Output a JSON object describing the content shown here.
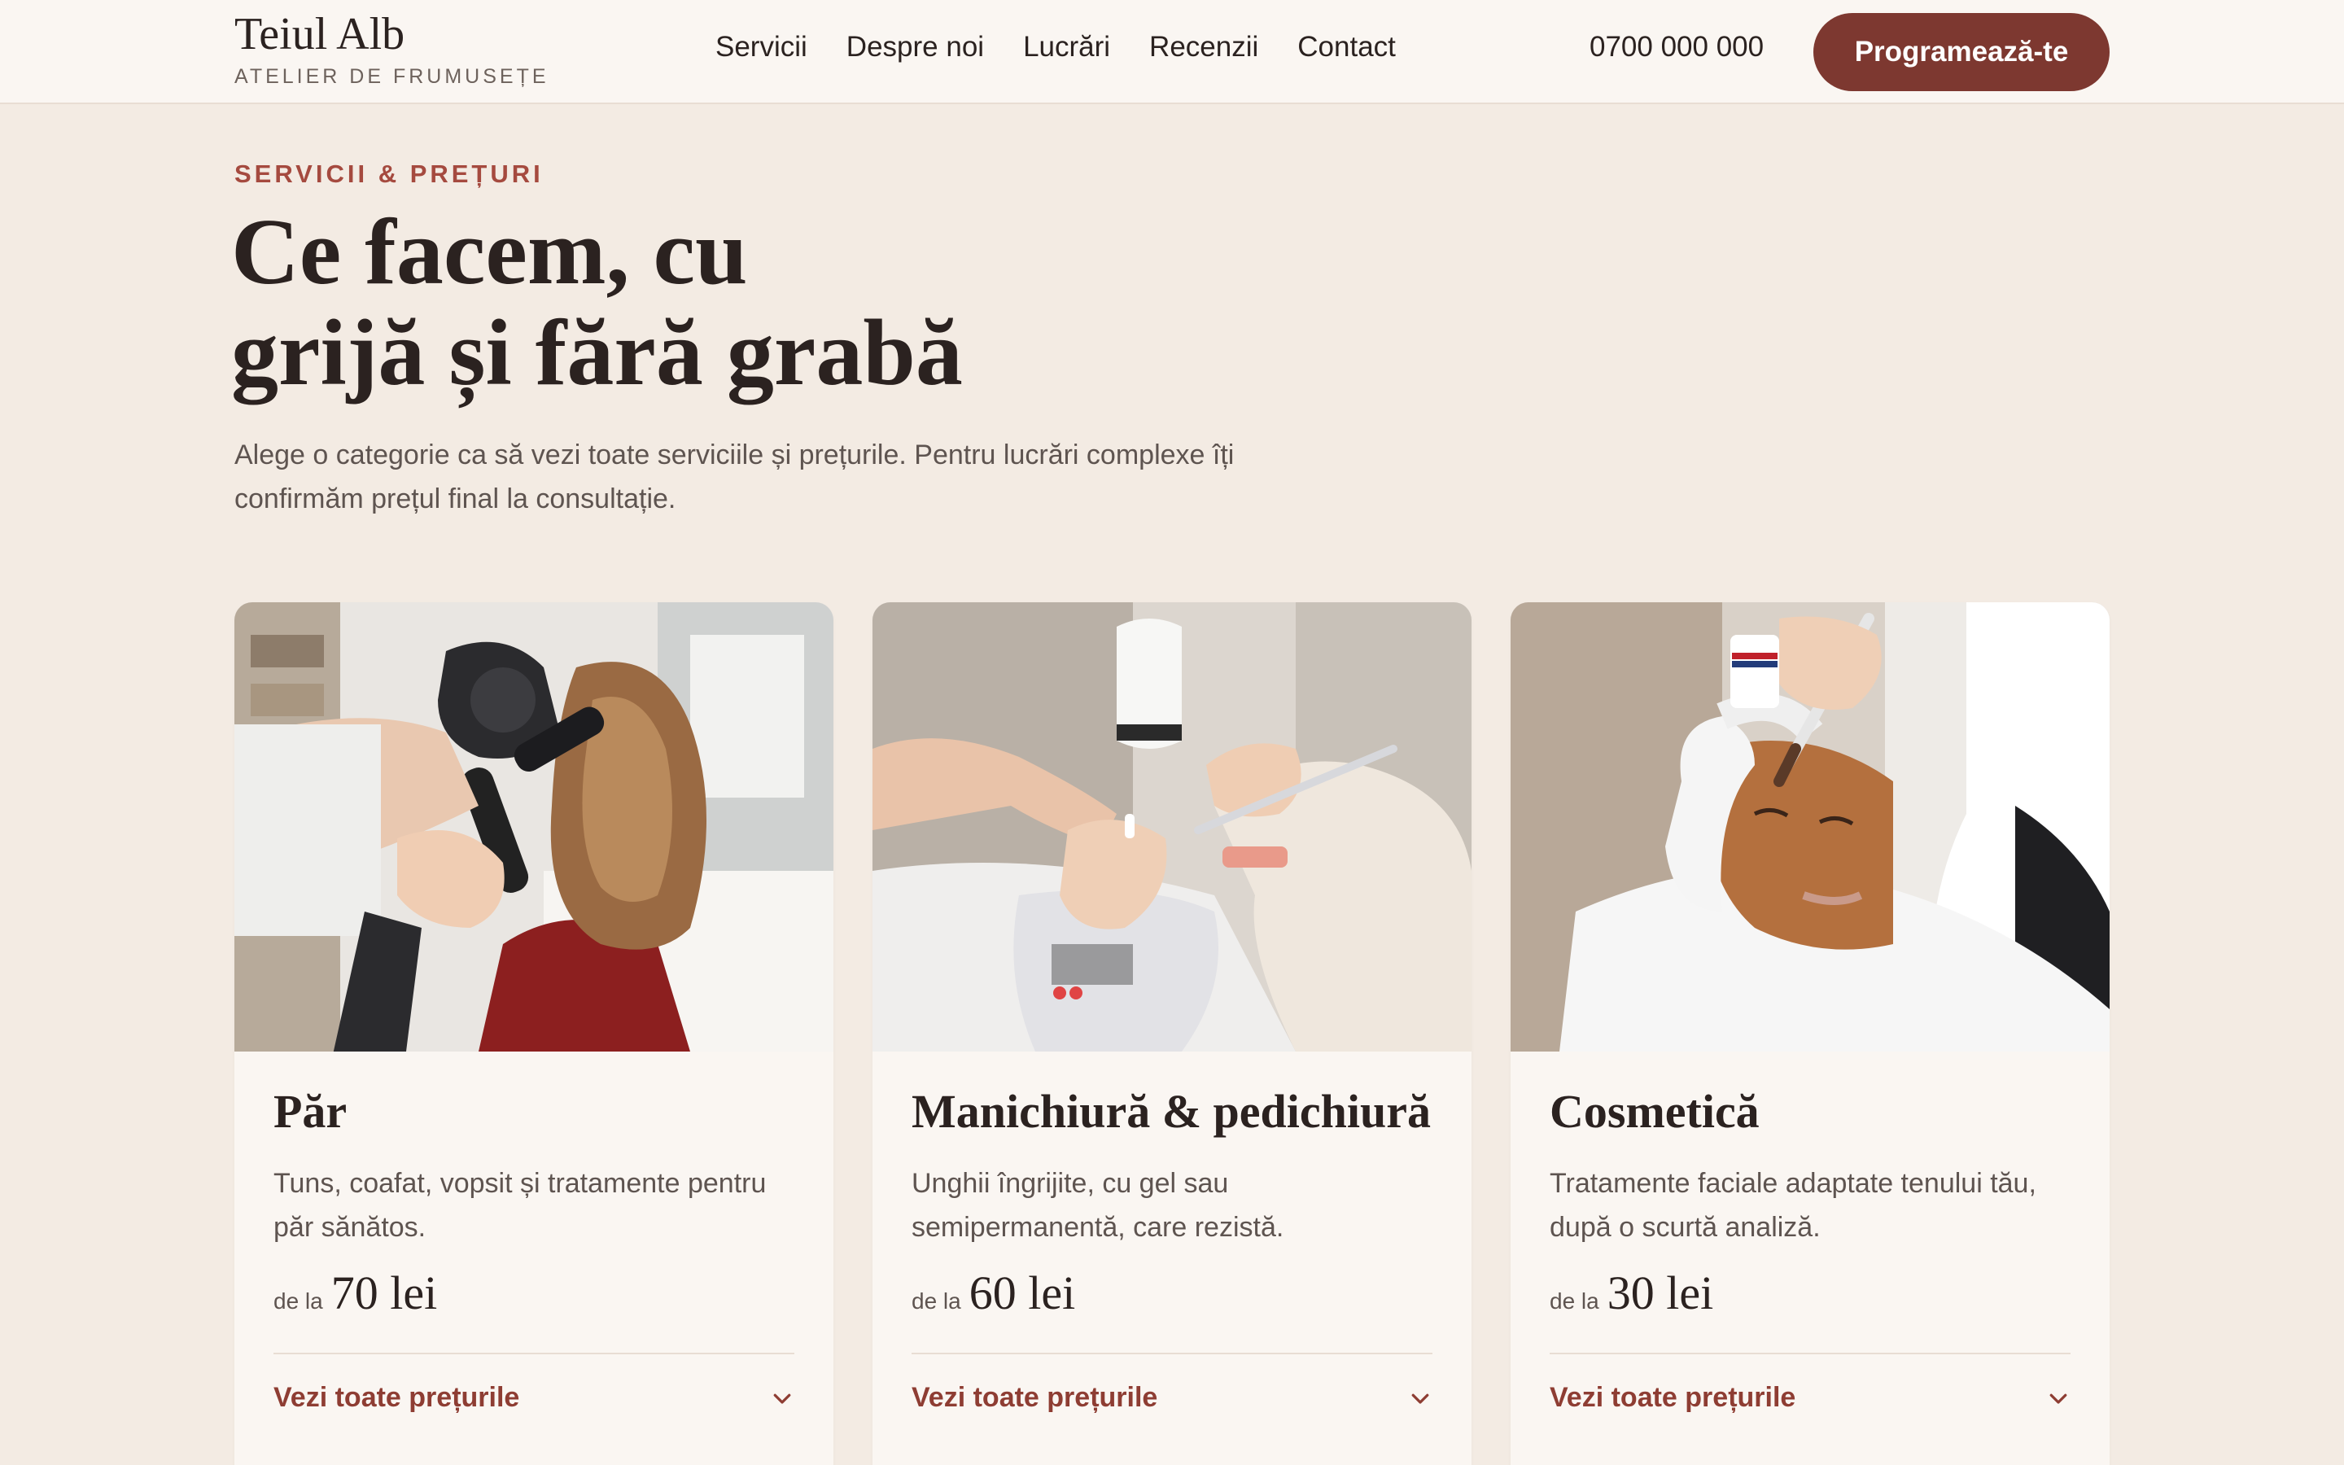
{
  "brand": {
    "name": "Teiul Alb",
    "tagline": "ATELIER DE FRUMUSEȚE"
  },
  "nav": {
    "items": [
      "Servicii",
      "Despre noi",
      "Lucrări",
      "Recenzii",
      "Contact"
    ]
  },
  "header": {
    "phone": "0700 000 000",
    "cta_label": "Programează-te"
  },
  "section": {
    "eyebrow": "SERVICII & PREȚURI",
    "headline_line1": "Ce facem, cu",
    "headline_line2": "grijă și fără grabă",
    "intro": "Alege o categorie ca să vezi toate serviciile și prețurile. Pentru lucrări complexe îți confirmăm prețul final la consultație."
  },
  "cards": [
    {
      "title": "Păr",
      "description": "Tuns, coafat, vopsit și tratamente pentru păr sănătos.",
      "price_prefix": "de la",
      "price": "70 lei",
      "toggle_label": "Vezi toate prețurile",
      "image_icon": "hair-styling-photo"
    },
    {
      "title": "Manichiură & pedichiură",
      "description": "Unghii îngrijite, cu gel sau semipermanentă, care rezistă.",
      "price_prefix": "de la",
      "price": "60 lei",
      "toggle_label": "Vezi toate prețurile",
      "image_icon": "manicure-photo"
    },
    {
      "title": "Cosmetică",
      "description": "Tratamente faciale adaptate tenului tău, după o scurtă analiză.",
      "price_prefix": "de la",
      "price": "30 lei",
      "toggle_label": "Vezi toate prețurile",
      "image_icon": "facial-treatment-photo"
    }
  ],
  "colors": {
    "accent": "#7d3830",
    "accent_text": "#a54a3f",
    "background": "#f3ebe3",
    "card": "#faf6f2"
  }
}
